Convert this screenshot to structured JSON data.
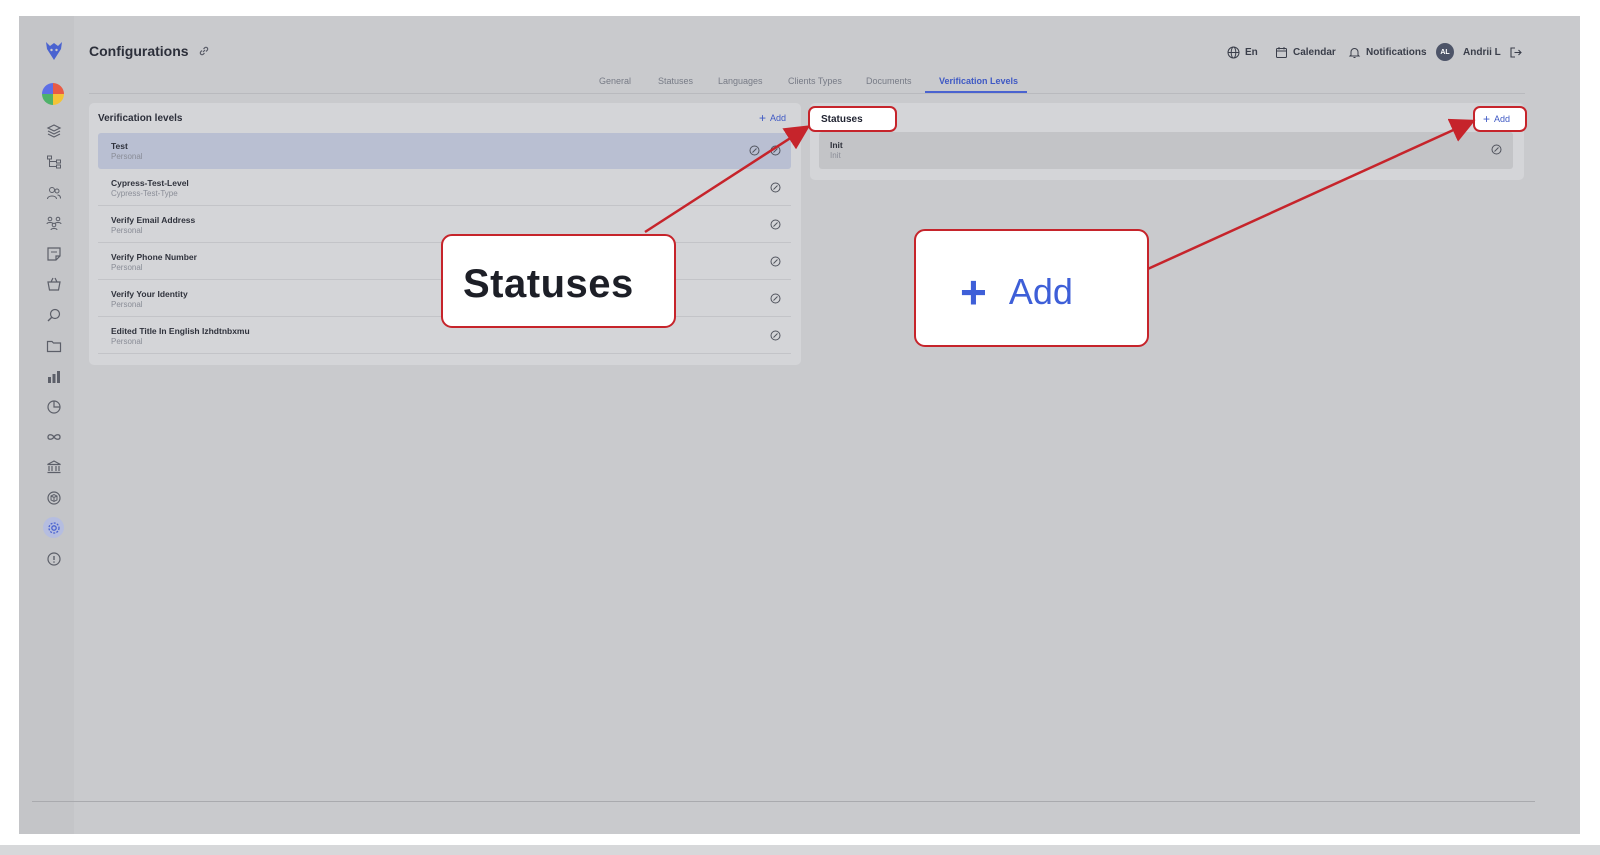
{
  "page": {
    "title": "Configurations"
  },
  "header": {
    "language": "En",
    "calendar": "Calendar",
    "notifications": "Notifications",
    "avatar_initials": "AL",
    "user_name": "Andrii L"
  },
  "tabs": [
    {
      "label": "General",
      "active": false
    },
    {
      "label": "Statuses",
      "active": false
    },
    {
      "label": "Languages",
      "active": false
    },
    {
      "label": "Clients Types",
      "active": false
    },
    {
      "label": "Documents",
      "active": false
    },
    {
      "label": "Verification Levels",
      "active": true
    }
  ],
  "levels_panel": {
    "title": "Verification levels",
    "add_label": "Add",
    "rows": [
      {
        "title": "Test",
        "subtitle": "Personal",
        "selected": true
      },
      {
        "title": "Cypress-Test-Level",
        "subtitle": "Cypress-Test-Type",
        "selected": false
      },
      {
        "title": "Verify Email Address",
        "subtitle": "Personal",
        "selected": false
      },
      {
        "title": "Verify Phone Number",
        "subtitle": "Personal",
        "selected": false
      },
      {
        "title": "Verify Your Identity",
        "subtitle": "Personal",
        "selected": false
      },
      {
        "title": "Edited Title In English Izhdtnbxmu",
        "subtitle": "Personal",
        "selected": false
      }
    ]
  },
  "statuses_panel": {
    "title": "Statuses",
    "add_label": "Add",
    "rows": [
      {
        "title": "Init",
        "subtitle": "Init"
      }
    ]
  },
  "callouts": {
    "statuses_zoom": "Statuses",
    "add_zoom_plus": "+",
    "add_zoom": "Add"
  },
  "colors": {
    "accent": "#3f59c4",
    "highlight": "#c6242b",
    "overlay": "#c9cacd"
  }
}
